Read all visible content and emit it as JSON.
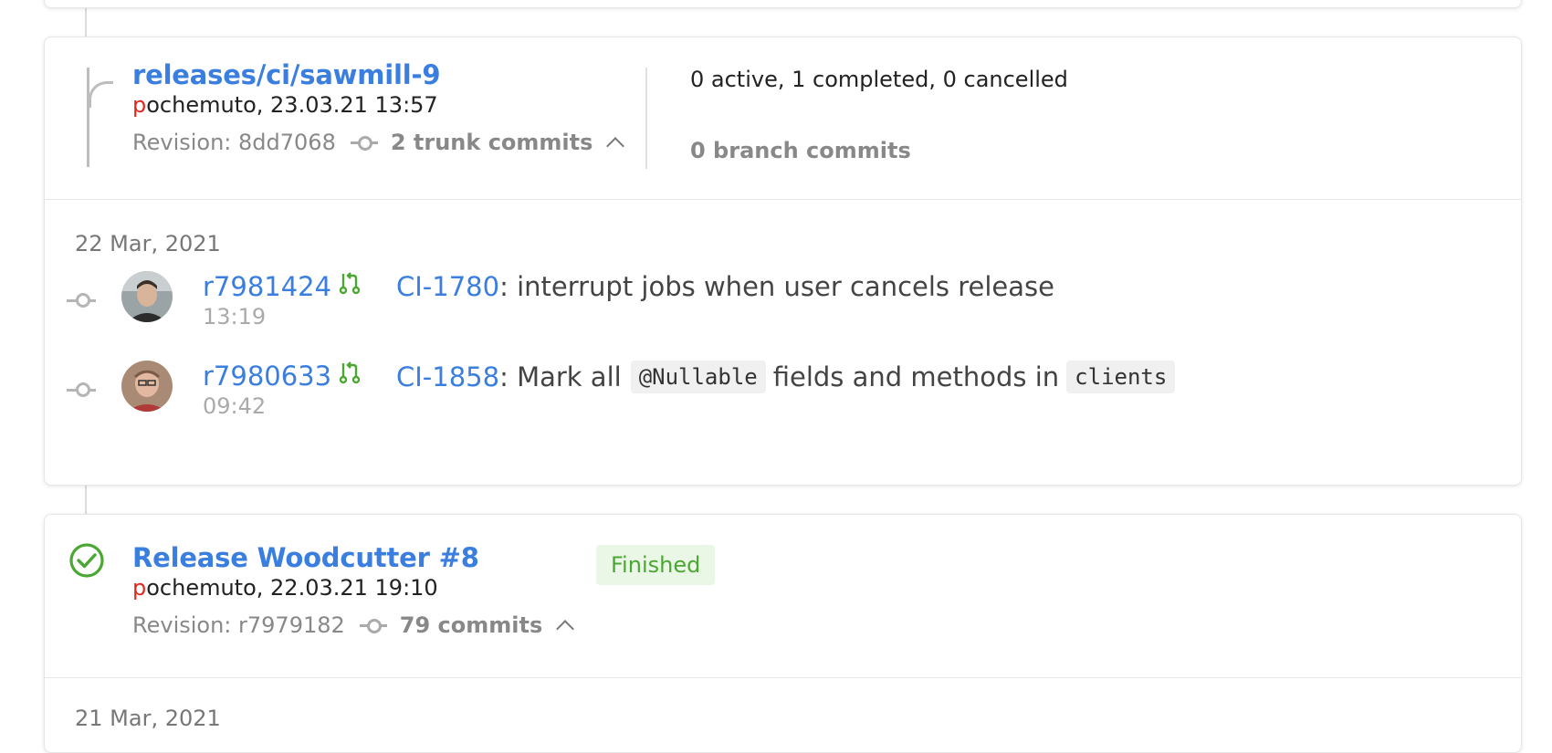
{
  "branch": {
    "title": "releases/ci/sawmill-9",
    "author_first": "p",
    "author_rest": "ochemuto, 23.03.21 13:57",
    "revision": "Revision: 8dd7068",
    "trunk_commits": "2 trunk commits",
    "stats": "0 active, 1 completed, 0 cancelled",
    "branch_commits": "0 branch commits"
  },
  "commit_group": {
    "date": "22 Mar, 2021",
    "commits": [
      {
        "revision": "r7981424",
        "time": "13:19",
        "ticket": "CI-1780",
        "message_parts": [
          ": interrupt jobs when user cancels release"
        ]
      },
      {
        "revision": "r7980633",
        "time": "09:42",
        "ticket": "CI-1858",
        "message_before": ": Mark all",
        "code1": "@Nullable",
        "message_mid": "fields and methods in",
        "code2": "clients"
      }
    ]
  },
  "release": {
    "title": "Release Woodcutter #8",
    "author_first": "p",
    "author_rest": "ochemuto, 22.03.21 19:10",
    "revision": "Revision: r7979182",
    "commits": "79 commits",
    "status": "Finished"
  },
  "next_date": "21 Mar, 2021",
  "colors": {
    "link": "#3a7ee0",
    "success": "#4aa832",
    "author_highlight": "#e3261d"
  },
  "icons": {
    "commit": "commit-node-icon",
    "pr": "pull-request-icon",
    "status": "check-circle-icon",
    "expand": "chevron-up-icon"
  }
}
